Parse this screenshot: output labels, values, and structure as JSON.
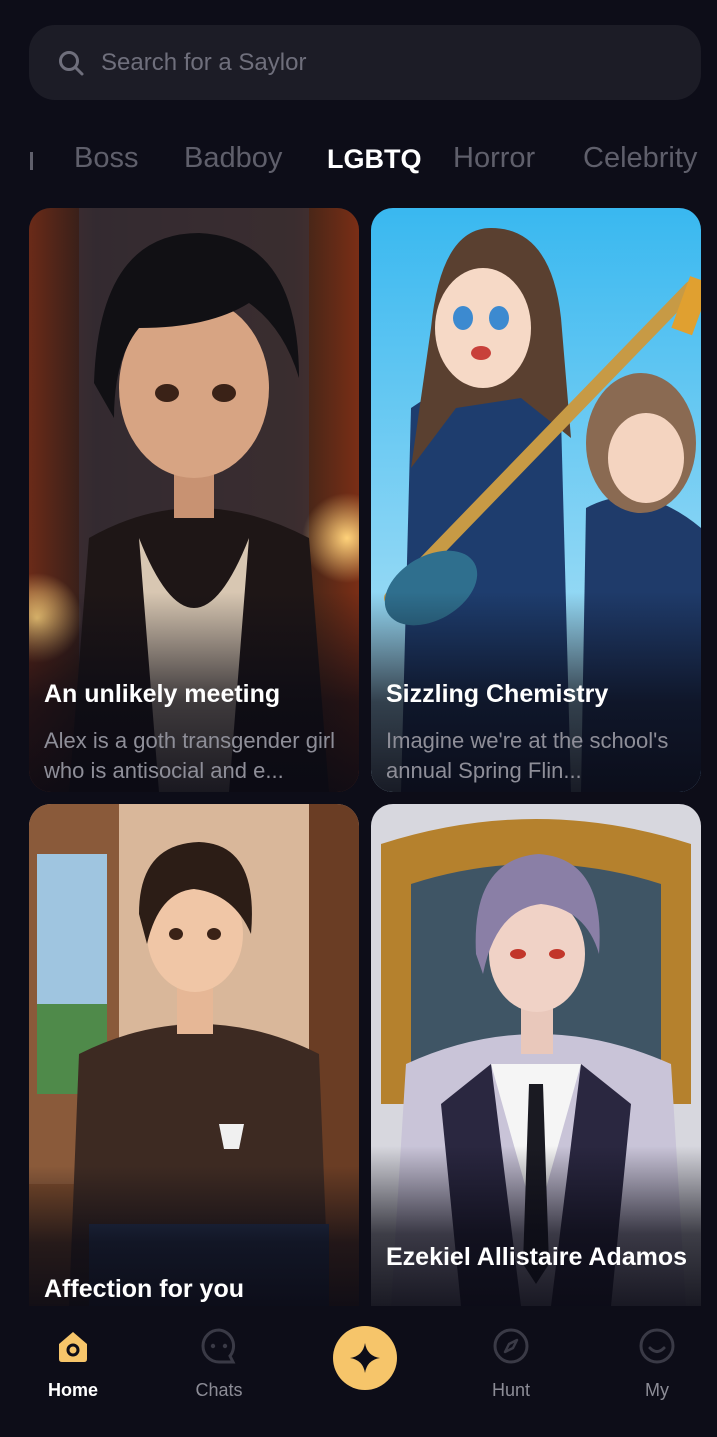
{
  "search": {
    "placeholder": "Search for a Saylor"
  },
  "tabs": [
    {
      "label": "Boss"
    },
    {
      "label": "Badboy"
    },
    {
      "label": "LGBTQ",
      "active": true
    },
    {
      "label": "Horror"
    },
    {
      "label": "Celebrity"
    }
  ],
  "cards": [
    {
      "title": "An unlikely meeting",
      "description": "Alex is a goth transgender girl who is antisocial and e..."
    },
    {
      "title": "Sizzling Chemistry",
      "description": "Imagine we're at the school's annual Spring Flin..."
    },
    {
      "title": "Affection for you",
      "description": ""
    },
    {
      "title": "Ezekiel Allistaire Adamos",
      "description": ""
    }
  ],
  "nav": {
    "items": [
      {
        "label": "Home",
        "icon": "home-icon",
        "active": true
      },
      {
        "label": "Chats",
        "icon": "chat-icon"
      },
      {
        "label": "",
        "icon": "sparkle-icon"
      },
      {
        "label": "Hunt",
        "icon": "compass-icon"
      },
      {
        "label": "My",
        "icon": "smile-icon"
      }
    ]
  },
  "colors": {
    "accent": "#f6c56a",
    "background": "#0d0d18"
  }
}
